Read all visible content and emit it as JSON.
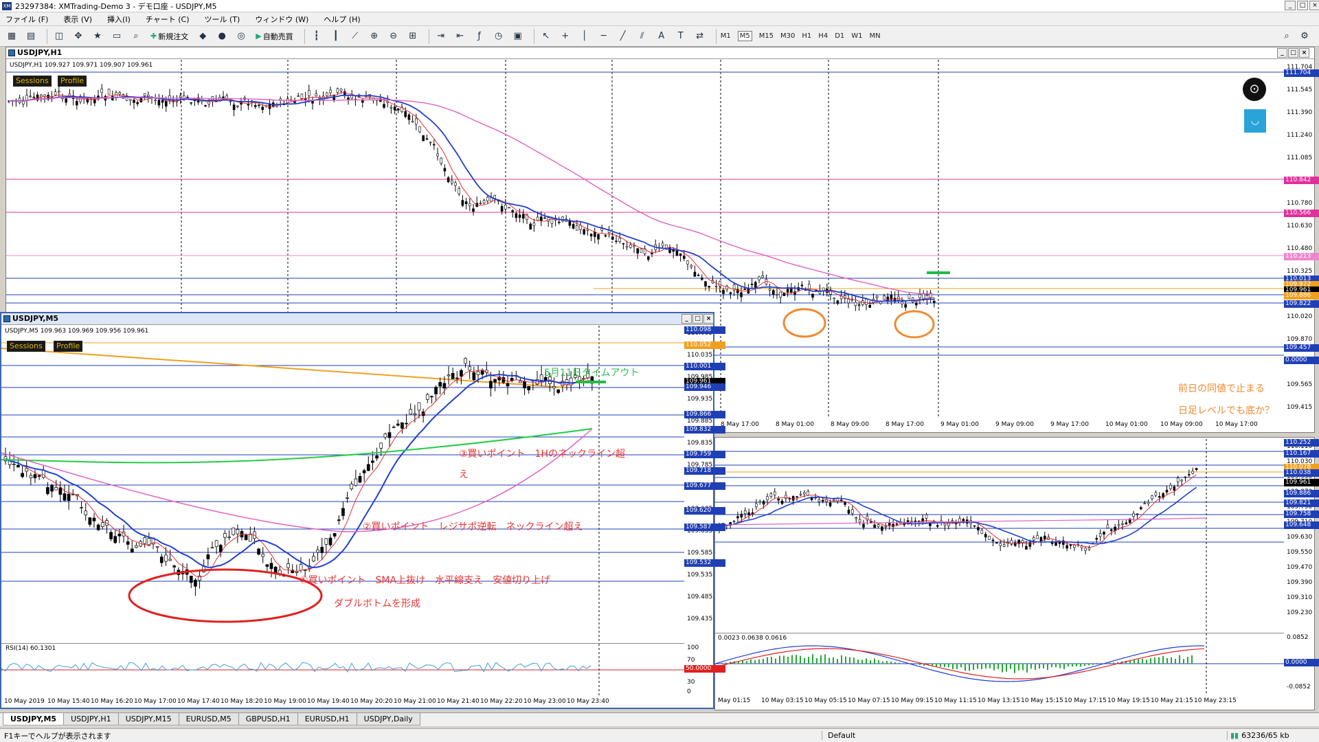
{
  "window": {
    "title": "23297384: XMTrading-Demo 3 - デモ口座 - USDJPY,M5"
  },
  "menu": [
    "ファイル (F)",
    "表示 (V)",
    "挿入(I)",
    "チャート (C)",
    "ツール (T)",
    "ウィンドウ (W)",
    "ヘルプ (H)"
  ],
  "toolbar": {
    "new_order": "新規注文",
    "auto_trade": "自動売買",
    "timeframes": [
      "M1",
      "M5",
      "M15",
      "M30",
      "H1",
      "H4",
      "D1",
      "W1",
      "MN"
    ],
    "active_tf": "M5"
  },
  "h1": {
    "title": "USDJPY,H1",
    "header": "USDJPY,H1 109.927 109.971 109.907 109.961",
    "badges": [
      "Sessions",
      "Profile"
    ],
    "price_ticks": [
      "111.704",
      "111.545",
      "111.390",
      "111.240",
      "111.085",
      "110.935",
      "110.780",
      "110.630",
      "110.480",
      "110.325",
      "110.175",
      "110.020",
      "109.870",
      "109.715",
      "109.565",
      "109.415"
    ],
    "level_labels": [
      {
        "text": "111.704",
        "color": "#1f3fb5"
      },
      {
        "text": "110.842",
        "color": "#e0309a"
      },
      {
        "text": "110.566",
        "color": "#e0309a"
      },
      {
        "text": "110.213",
        "color": "#ee88cc"
      },
      {
        "text": "110.013",
        "color": "#1f3fb5"
      },
      {
        "text": "109.972",
        "color": "#f0a020"
      },
      {
        "text": "109.961",
        "color": "#000000"
      },
      {
        "text": "109.886",
        "color": "#f0a020"
      },
      {
        "text": "109.822",
        "color": "#1f3fb5"
      },
      {
        "text": "109.457",
        "color": "#1f3fb5"
      },
      {
        "text": "0.0000",
        "color": "#1f3fb5"
      }
    ],
    "time_ticks": [
      "8 May 17:00",
      "8 May 01:00",
      "8 May 09:00",
      "8 May 17:00",
      "9 May 01:00",
      "9 May 09:00",
      "9 May 17:00",
      "10 May 01:00",
      "10 May 09:00",
      "10 May 17:00"
    ],
    "annotations": [
      "前日の同値で止まる",
      "日足レベルでも底か？"
    ]
  },
  "m5": {
    "title": "USDJPY,M5",
    "header": "USDJPY,M5 109.963 109.969 109.956 109.961",
    "badges": [
      "Sessions",
      "Profile"
    ],
    "price_ticks": [
      "110.085",
      "110.035",
      "109.985",
      "109.935",
      "109.885",
      "109.835",
      "109.785",
      "109.735",
      "109.685",
      "109.635",
      "109.585",
      "109.535",
      "109.485",
      "109.435"
    ],
    "level_labels": [
      {
        "text": "110.098",
        "color": "#1f3fb5"
      },
      {
        "text": "110.052",
        "color": "#f0a020"
      },
      {
        "text": "110.001",
        "color": "#1f3fb5"
      },
      {
        "text": "109.961",
        "color": "#000000"
      },
      {
        "text": "109.946",
        "color": "#1f3fb5"
      },
      {
        "text": "109.866",
        "color": "#1f3fb5"
      },
      {
        "text": "109.832",
        "color": "#1f3fb5"
      },
      {
        "text": "109.759",
        "color": "#1f3fb5"
      },
      {
        "text": "109.718",
        "color": "#1f3fb5"
      },
      {
        "text": "109.677",
        "color": "#1f3fb5"
      },
      {
        "text": "109.620",
        "color": "#1f3fb5"
      },
      {
        "text": "109.587",
        "color": "#1f3fb5"
      },
      {
        "text": "109.532",
        "color": "#1f3fb5"
      }
    ],
    "rsi_label": "RSI(14) 60.1301",
    "rsi_ticks": [
      "100",
      "70",
      "30",
      "0"
    ],
    "rsi_level": "50.0000",
    "time_ticks": [
      "10 May 2019",
      "10 May 15:40",
      "10 May 16:20",
      "10 May 17:00",
      "10 May 17:40",
      "10 May 18:20",
      "10 May 19:00",
      "10 May 19:40",
      "10 May 20:20",
      "10 May 21:00",
      "10 May 21:40",
      "10 May 22:20",
      "10 May 23:00",
      "10 May 23:40"
    ],
    "annotations": [
      "5月11日タイムアウト",
      "③買いポイント　1Hのネックライン超",
      "え",
      "②買いポイント　レジサポ逆転　ネックライン超え",
      "①買いポイント　SMA上抜け　水平線支え　安値切り上げ",
      "ダブルボトムを形成"
    ]
  },
  "br": {
    "price_ticks": [
      "110.110",
      "110.030",
      "109.950",
      "109.870",
      "109.790",
      "109.710",
      "109.630",
      "109.550",
      "109.470",
      "109.390",
      "109.310",
      "109.230"
    ],
    "level_labels": [
      {
        "text": "110.252",
        "color": "#1f3fb5"
      },
      {
        "text": "110.167",
        "color": "#1f3fb5"
      },
      {
        "text": "110.078",
        "color": "#f0a020"
      },
      {
        "text": "110.038",
        "color": "#1f3fb5"
      },
      {
        "text": "109.961",
        "color": "#000000"
      },
      {
        "text": "109.886",
        "color": "#1f3fb5"
      },
      {
        "text": "109.821",
        "color": "#1f3fb5"
      },
      {
        "text": "109.758",
        "color": "#1f3fb5"
      },
      {
        "text": "109.648",
        "color": "#1f3fb5"
      }
    ],
    "macd_label": "0.0023 0.0638 0.0616",
    "macd_ticks": [
      "0.0852",
      "0.0000",
      "-0.0852"
    ],
    "time_ticks": [
      "May 01:15",
      "10 May 03:15",
      "10 May 05:15",
      "10 May 07:15",
      "10 May 09:15",
      "10 May 11:15",
      "10 May 13:15",
      "10 May 15:15",
      "10 May 17:15",
      "10 May 19:15",
      "10 May 21:15",
      "10 May 23:15"
    ]
  },
  "tabs": [
    "USDJPY,M5",
    "USDJPY,H1",
    "USDJPY,M15",
    "EURUSD,M5",
    "GBPUSD,H1",
    "EURUSD,H1",
    "USDJPY,Daily"
  ],
  "status": {
    "help": "F1キーでヘルプが表示されます",
    "profile": "Default",
    "traffic": "63236/65 kb"
  }
}
